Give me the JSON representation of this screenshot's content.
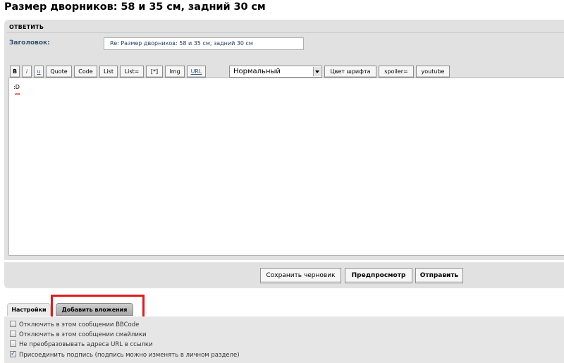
{
  "page": {
    "title": "Размер дворников: 58 и 35 см, задний 30 см"
  },
  "reply_panel": {
    "heading": "ОТВЕТИТЬ",
    "subject_label": "Заголовок:",
    "subject_value": "Re: Размер дворников: 58 и 35 см, задний 30 см"
  },
  "toolbar": {
    "bold": "B",
    "italic": "i",
    "underline": "u",
    "quote": "Quote",
    "code": "Code",
    "list": "List",
    "list_eq": "List=",
    "list_item": "[*]",
    "img": "Img",
    "url": "URL",
    "font_size_selected": "Нормальный",
    "font_color": "Цвет шрифта",
    "spoiler": "spoiler=",
    "youtube": "youtube"
  },
  "editor": {
    "content": ":D"
  },
  "actions": {
    "save_draft": "Сохранить черновик",
    "preview": "Предпросмотр",
    "submit": "Отправить"
  },
  "tabs": {
    "settings": "Настройки",
    "attachments": "Добавить вложения"
  },
  "options": [
    {
      "label": "Отключить в этом сообщении BBCode",
      "checked": false
    },
    {
      "label": "Отключить в этом сообщении смайлики",
      "checked": false
    },
    {
      "label": "Не преобразовывать адреса URL в ссылки",
      "checked": false
    },
    {
      "label": "Присоединить подпись (подпись можно изменять в личном разделе)",
      "checked": true
    }
  ],
  "colors": {
    "panel_bg": "#e1e1e1",
    "label_blue": "#2f5576",
    "highlight_red": "#e21b1b"
  }
}
